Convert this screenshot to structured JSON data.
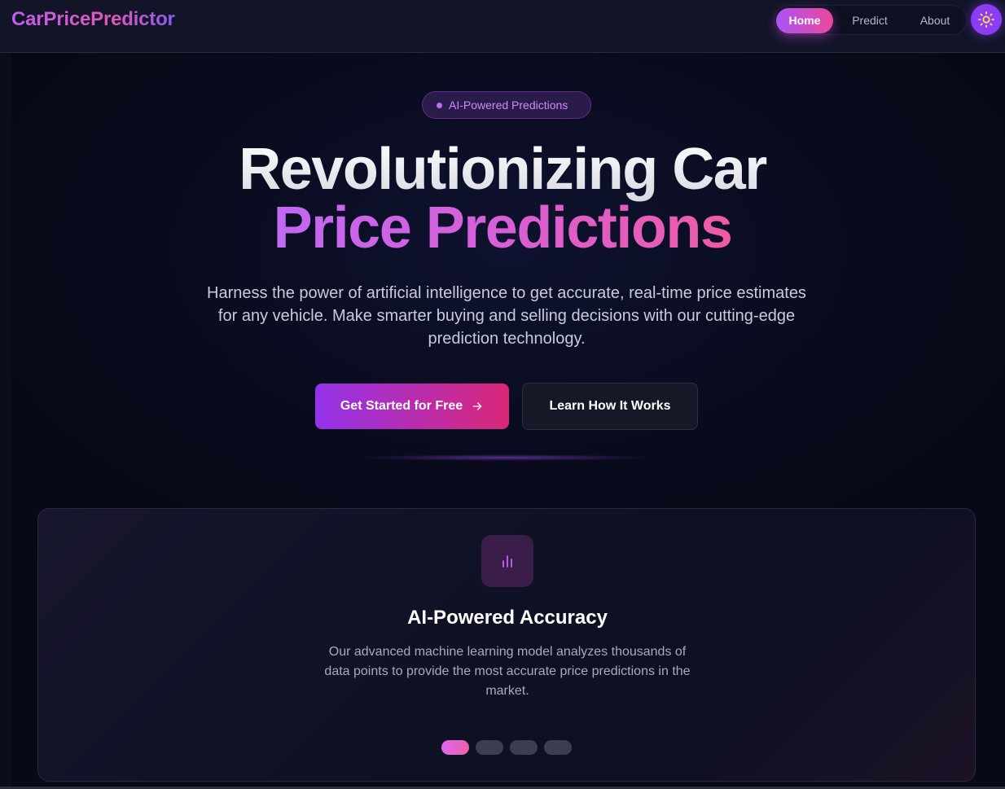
{
  "brand": {
    "name": "CarPricePredictor"
  },
  "nav": {
    "items": [
      {
        "label": "Home",
        "active": true
      },
      {
        "label": "Predict",
        "active": false
      },
      {
        "label": "About",
        "active": false
      }
    ],
    "theme_toggle_icon": "sun-icon"
  },
  "hero": {
    "badge": "AI-Powered Predictions",
    "title_line1": "Revolutionizing Car",
    "title_line2": "Price Predictions",
    "subtitle": "Harness the power of artificial intelligence to get accurate, real-time price estimates for any vehicle. Make smarter buying and selling decisions with our cutting-edge prediction technology.",
    "primary_cta": "Get Started for Free",
    "secondary_cta": "Learn How It Works"
  },
  "feature_card": {
    "icon": "bar-chart-icon",
    "title": "AI-Powered Accuracy",
    "text": "Our advanced machine learning model analyzes thousands of data points to provide the most accurate price predictions in the market.",
    "slide_count": 4,
    "active_slide": 1
  },
  "colors": {
    "accent_purple": "#a855f7",
    "accent_pink": "#ec4899",
    "background": "#080a18"
  }
}
